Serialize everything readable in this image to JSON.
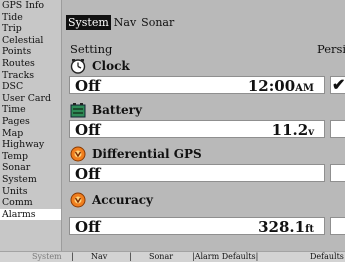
{
  "sidebar": {
    "items": [
      {
        "label": "GPS Info"
      },
      {
        "label": "Tide"
      },
      {
        "label": "Trip"
      },
      {
        "label": "Celestial"
      },
      {
        "label": "Points"
      },
      {
        "label": "Routes"
      },
      {
        "label": "Tracks"
      },
      {
        "label": "DSC"
      },
      {
        "label": "User Card"
      },
      {
        "label": "Time"
      },
      {
        "label": "Pages"
      },
      {
        "label": "Map"
      },
      {
        "label": "Highway"
      },
      {
        "label": "Temp"
      },
      {
        "label": "Sonar"
      },
      {
        "label": "System"
      },
      {
        "label": "Units"
      },
      {
        "label": "Comm"
      },
      {
        "label": "Alarms"
      }
    ],
    "active": "Alarms"
  },
  "tabs": [
    {
      "label": "System"
    },
    {
      "label": "Nav"
    },
    {
      "label": "Sonar"
    }
  ],
  "active_tab": "System",
  "header": {
    "setting": "Setting",
    "persist": "Persi"
  },
  "rows": [
    {
      "label": "Clock",
      "icon": "clock-icon",
      "value_text": "Off",
      "value_num": "12:00",
      "value_unit": "AM",
      "checked": true
    },
    {
      "label": "Battery",
      "icon": "battery-icon",
      "value_text": "Off",
      "value_num": "11.2",
      "value_unit": "v",
      "checked": false
    },
    {
      "label": "Differential GPS",
      "icon": "warning-icon",
      "value_text": "Off",
      "value_num": "",
      "value_unit": "",
      "checked": false
    },
    {
      "label": "Accuracy",
      "icon": "warning-icon",
      "value_text": "Off",
      "value_num": "328.1",
      "value_unit": "ft",
      "checked": false
    }
  ],
  "softkeys": {
    "system": "System",
    "nav": "Nav",
    "sonar": "Sonar",
    "alarm_defaults": "|Alarm Defaults|",
    "defaults": "Defaults",
    "sep": "|"
  },
  "colors": {
    "active_tab_bg": "#111111",
    "sidebar_active_bg": "#ffffff",
    "icon_orange": "#f07e1e"
  }
}
